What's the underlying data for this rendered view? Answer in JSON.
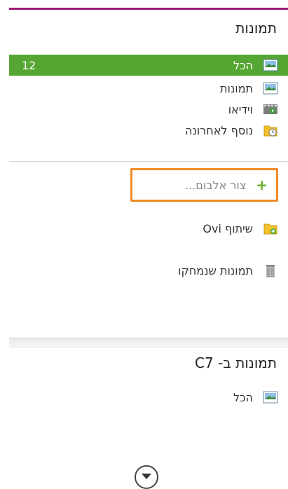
{
  "section_photos": {
    "title": "תמונות",
    "items": [
      {
        "label": "הכל",
        "count": "12",
        "icon": "image-icon"
      },
      {
        "label": "תמונות",
        "icon": "image-icon"
      },
      {
        "label": "וידיאו",
        "icon": "video-icon"
      },
      {
        "label": "נוסף לאחרונה",
        "icon": "recent-folder-icon"
      }
    ],
    "create_album": {
      "label": "צור אלבום...",
      "icon": "plus-icon"
    },
    "share": {
      "label": "שיתוף Ovi",
      "icon": "share-folder-icon"
    },
    "deleted": {
      "label": "תמונות שנמחקו",
      "icon": "trash-icon"
    }
  },
  "section_device": {
    "title": "תמונות ב- C7",
    "items": [
      {
        "label": "הכל",
        "icon": "image-icon"
      }
    ]
  },
  "colors": {
    "accent_top": "#9c1a7a",
    "selected_bg": "#56a633",
    "highlight_border": "#f08a23"
  }
}
